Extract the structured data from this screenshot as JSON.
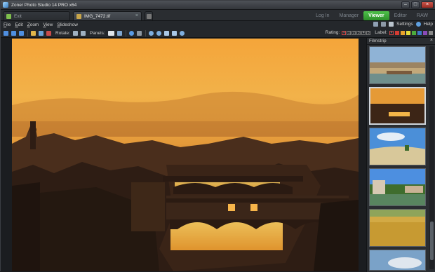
{
  "window": {
    "title": "Zoner Photo Studio 14 PRO x64"
  },
  "tabs": [
    {
      "label": "Exit",
      "active": false
    },
    {
      "label": "IMG_7472.tif",
      "active": true
    }
  ],
  "modes": [
    "Log In",
    "Manager",
    "Viewer",
    "Editor",
    "RAW"
  ],
  "active_mode": "Viewer",
  "menu": {
    "items": [
      "File",
      "Edit",
      "Zoom",
      "View",
      "Slideshow"
    ],
    "settings_label": "Settings",
    "help_label": "Help"
  },
  "toolbar": {
    "rotate_label": "Rotate:",
    "panels_label": "Panels:",
    "rating_label": "Rating:",
    "rating_values": [
      "1",
      "2",
      "3",
      "4",
      "5"
    ],
    "label_label": "Label:",
    "label_colors": [
      "#d33b32",
      "#e8a22c",
      "#e3dc3a",
      "#4cab3c",
      "#3d78c7",
      "#8a4ab8",
      "#888888"
    ]
  },
  "filmstrip": {
    "title": "Filmstrip",
    "thumbnails": [
      {
        "name": "Ponte Vecchio in daylight",
        "selected": false
      },
      {
        "name": "Ponte Vecchio at sunset",
        "selected": true
      },
      {
        "name": "Tuscan hill under blue sky",
        "selected": false
      },
      {
        "name": "Riverside village",
        "selected": false
      },
      {
        "name": "Golden wheat field",
        "selected": false
      },
      {
        "name": "Sky with clouds",
        "selected": false
      }
    ]
  },
  "colors": {
    "accent_viewer": "#3fb23b",
    "titlebar": "#3a3d42"
  }
}
